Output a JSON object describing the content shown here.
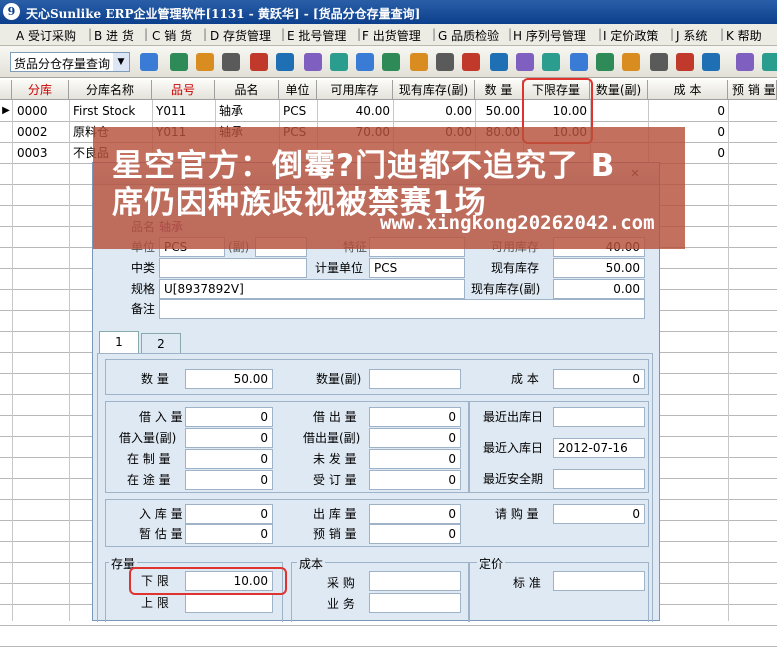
{
  "window": {
    "title": "天心Sunlike ERP企业管理软件[1131 - 黄跃华] - [货品分仓存量查询]",
    "icon_glyph": "9"
  },
  "menu": [
    {
      "label": "A 受订采购"
    },
    {
      "label": "B 进 货"
    },
    {
      "label": "C 销 货"
    },
    {
      "label": "D 存货管理"
    },
    {
      "label": "E 批号管理"
    },
    {
      "label": "F 出货管理"
    },
    {
      "label": "G 品质检验"
    },
    {
      "label": "H 序列号管理"
    },
    {
      "label": "I 定价政策"
    },
    {
      "label": "J 系统"
    },
    {
      "label": "K 帮助"
    }
  ],
  "toolbar": {
    "combo_value": "货品分仓存量查询",
    "icons": [
      "tool-1-icon",
      "tool-2-icon",
      "tool-3-icon",
      "tool-4-icon",
      "tool-5-icon",
      "tool-6-icon",
      "tool-7-icon",
      "tool-8-icon",
      "tool-9-icon",
      "tool-10-icon",
      "tool-11-icon",
      "tool-12-icon",
      "tool-13-icon",
      "tool-14-icon",
      "tool-15-icon",
      "tool-16-icon",
      "tool-17-icon",
      "tool-18-icon",
      "tool-19-icon",
      "tool-20-icon",
      "tool-21-icon",
      "tool-22-icon",
      "tool-23-icon",
      "tool-24-icon",
      "tool-25-icon",
      "tool-26-icon"
    ]
  },
  "grid": {
    "columns": [
      "分库",
      "分库名称",
      "品号",
      "品名",
      "单位",
      "可用库存",
      "现有库存(副)",
      "数 量",
      "下限存量",
      "数量(副)",
      "成 本",
      "预 销 量"
    ],
    "rows": [
      {
        "c0": "0000",
        "c1": "First Stock",
        "c2": "Y011",
        "c3": "轴承",
        "c4": "PCS",
        "c5": "40.00",
        "c6": "0.00",
        "c7": "50.00",
        "c8": "10.00",
        "c10": "0"
      },
      {
        "c0": "0002",
        "c1": "原料仓",
        "c2": "Y011",
        "c3": "轴承",
        "c4": "PCS",
        "c5": "70.00",
        "c6": "0.00",
        "c7": "80.00",
        "c8": "10.00",
        "c10": "0"
      },
      {
        "c0": "0003",
        "c1": "不良品",
        "c2": "",
        "c3": "",
        "c4": "",
        "c5": "",
        "c6": "",
        "c7": "",
        "c8": "",
        "c10": "0"
      }
    ]
  },
  "dialog": {
    "header": {
      "品名_label": "品名",
      "品名_value": "轴承",
      "单位_label": "单位",
      "单位_value": "PCS",
      "副_label": "(副)",
      "特征_label": "特征",
      "可用库存_label": "可用库存",
      "可用库存_value": "40.00",
      "中类_label": "中类",
      "计量单位_label": "计量单位",
      "计量单位_value": "PCS",
      "现有库存_label": "现有库存",
      "现有库存_value": "50.00",
      "规格_label": "规格",
      "规格_value": "U[8937892V]",
      "现有库存副_label": "现有库存(副)",
      "现有库存副_value": "0.00",
      "备注_label": "备注"
    },
    "tabs": [
      "1",
      "2"
    ],
    "qty": {
      "数量_label": "数 量",
      "数量_value": "50.00",
      "数量副_label": "数量(副)",
      "成本_label": "成 本",
      "成本_value": "0"
    },
    "left": [
      {
        "label": "借 入 量",
        "value": "0"
      },
      {
        "label": "借入量(副)",
        "value": "0"
      },
      {
        "label": "在 制 量",
        "value": "0"
      },
      {
        "label": "在 途 量",
        "value": "0"
      }
    ],
    "mid": [
      {
        "label": "借 出 量",
        "value": "0"
      },
      {
        "label": "借出量(副)",
        "value": "0"
      },
      {
        "label": "未 发 量",
        "value": "0"
      },
      {
        "label": "受 订 量",
        "value": "0"
      }
    ],
    "dates": [
      {
        "label": "最近出库日",
        "value": ""
      },
      {
        "label": "最近入库日",
        "value": "2012-07-16"
      },
      {
        "label": "最近安全期",
        "value": ""
      }
    ],
    "left2": [
      {
        "label": "入 库 量",
        "value": "0"
      },
      {
        "label": "暂 估 量",
        "value": "0"
      }
    ],
    "mid2": [
      {
        "label": "出 库 量",
        "value": "0"
      },
      {
        "label": "预 销 量",
        "value": "0"
      }
    ],
    "purchase": {
      "label": "请 购 量",
      "value": "0"
    },
    "stock": {
      "title": "存量",
      "lower_label": "下 限",
      "lower_value": "10.00",
      "upper_label": "上 限",
      "upper_value": ""
    },
    "cost": {
      "title": "成本",
      "purchase_label": "采 购",
      "business_label": "业 务"
    },
    "price": {
      "title": "定价",
      "std_label": "标 准"
    }
  },
  "watermark": {
    "line1": "星空官方：倒霉?门迪都不追究了 B",
    "line2": "席仍因种族歧视被禁赛1场",
    "url": "www.xingkong20262042.com"
  },
  "colors": {
    "highlight": "#e0332f",
    "title_bar": "#0c3f8c",
    "watermark_bg": "#b7503a"
  }
}
